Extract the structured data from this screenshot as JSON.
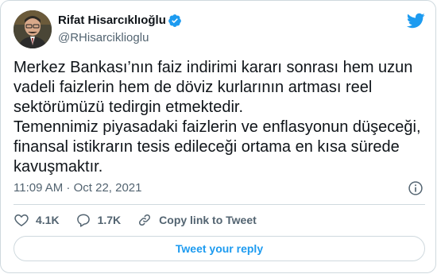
{
  "author": {
    "name": "Rifat Hisarcıklıoğlu",
    "handle": "@RHisarciklioglu",
    "verified": true
  },
  "tweet": {
    "text": "Merkez Bankası’nın faiz indirimi kararı sonrası hem uzun\nvadeli faizlerin hem de döviz kurlarının artması reel\nsektörümüzü tedirgin etmektedir.\nTemennimiz piyasadaki faizlerin ve enflasyonun düşeceği,\nfinansal istikrarın tesis edileceği ortama en kısa sürede\nkavuşmaktır.",
    "timestamp": "11:09 AM · Oct 22, 2021"
  },
  "actions": {
    "likes": "4.1K",
    "replies": "1.7K",
    "copy_link_label": "Copy link to Tweet"
  },
  "reply_button_label": "Tweet your reply",
  "colors": {
    "accent": "#1d9bf0",
    "secondary_text": "#536471",
    "border": "#cfd9de"
  },
  "icons": {
    "verified": "verified-badge-icon",
    "brand": "twitter-bird-icon",
    "info": "info-icon",
    "like": "heart-icon",
    "reply": "speech-bubble-icon",
    "share": "link-icon"
  }
}
